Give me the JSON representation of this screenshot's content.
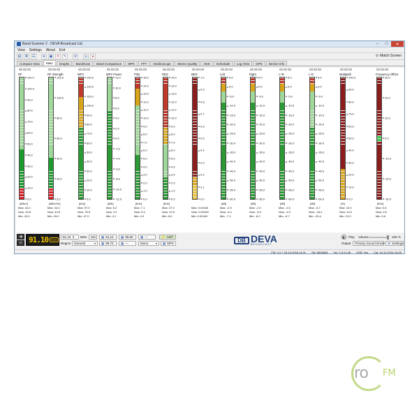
{
  "window": {
    "title": "Band Scanner 2 - DEVA Broadcast Ltd."
  },
  "menu": [
    "View",
    "Settings",
    "About",
    "Exit"
  ],
  "toolbar": {
    "match_screen": "Match Screen"
  },
  "tabs": [
    "Compact View",
    "Main",
    "Graphs",
    "BandScan",
    "Band Comparison",
    "MPX",
    "FFT",
    "Oscilloscope",
    "Stereo Quality",
    "ADS",
    "Scheduler",
    "Log View",
    "GPS",
    "Device Info"
  ],
  "active_tab": "Main",
  "meters": [
    {
      "title": "RF",
      "unit": "[dBuV]",
      "ticks": [
        "110.0",
        "100.0",
        "90.0",
        "80.0",
        "70.0",
        "60.0",
        "50.0",
        "40.0",
        "30.0",
        "20.0",
        "10.0",
        "0.0"
      ],
      "level": 0.4,
      "scheme": "rf",
      "stats": [
        "Max: 44.0",
        "Now: 43.8",
        "Min: 43.0"
      ]
    },
    {
      "title": "RF Strength",
      "unit": "[dBuV/m]",
      "ticks": [
        "125.0",
        "105.0",
        "85.0",
        "65.0",
        "45.0",
        "25.0",
        "5.0"
      ],
      "level": 0.33,
      "scheme": "rf",
      "stats": [
        "Max: 44.0",
        "Now: 43.8",
        "Min: 43.0"
      ]
    },
    {
      "title": "MPX",
      "unit": "[kHz]",
      "ticks": [
        "130.0",
        "120.0",
        "110.0",
        "100.0",
        "90.0",
        "80.0",
        "70.0",
        "60.0",
        "50.0",
        "40.0",
        "30.0",
        "20.0",
        "10.0",
        "0.0"
      ],
      "level": 0.62,
      "scheme": "mpx",
      "stats": [
        "Max: 97.0",
        "Now: 78.5",
        "Min: 47.0"
      ]
    },
    {
      "title": "MPX Power",
      "unit": "[dBr]",
      "ticks": [
        "12.0",
        "10.0",
        "8.0",
        "6.0",
        "4.0",
        "2.0",
        "0.0",
        "-2.0",
        "-4.0",
        "-6.0",
        "-8.0",
        "-10.0",
        "-12.0"
      ],
      "level": 0.72,
      "scheme": "green",
      "stats": [
        "Max: 6.2",
        "Now: 4.1",
        "Min: 4.1"
      ]
    },
    {
      "title": "Pilot",
      "unit": "[kHz]",
      "ticks": [
        "15.0",
        "14.0",
        "13.0",
        "12.0",
        "11.0",
        "10.0",
        "9.0",
        "8.0",
        "7.0",
        "6.0",
        "5.0",
        "4.0",
        "3.0",
        "2.0",
        "1.0",
        "0.0"
      ],
      "level": 0.36,
      "scheme": "pilot",
      "stats": [
        "Max: 7.1",
        "Now: 5.4",
        "Min: 4.3"
      ]
    },
    {
      "title": "RDS",
      "unit": "[kHz]",
      "ticks": [
        "15.0",
        "14.0",
        "13.0",
        "12.0",
        "11.0",
        "10.0",
        "9.0",
        "8.0",
        "7.0",
        "6.0",
        "5.0",
        "4.0",
        "3.0",
        "2.0",
        "1.0",
        "0.0"
      ],
      "level": 0.18,
      "scheme": "rds",
      "stats": [
        "Max: 27.0",
        "Now: 12.5",
        "Min: 8.0"
      ]
    },
    {
      "title": "BER",
      "unit": "",
      "ticks": [
        "1.0",
        "0.9",
        "0.8",
        "0.7",
        "0.6",
        "0.5",
        "0.4",
        "0.3",
        "0.2",
        "0.1",
        "0.0"
      ],
      "level": 0.0,
      "scheme": "ber",
      "stats": [
        "Max: 0.00160",
        "Now: 0.00160",
        "Min: 0.00160"
      ]
    },
    {
      "title": "Left",
      "unit": "[dB]",
      "ticks": [
        "5.0",
        "0.0",
        "-5.0",
        "-10.0",
        "-15.0",
        "-20.0",
        "-25.0",
        "-30.0",
        "-35.0",
        "-40.0",
        "-45.0",
        "-50.0",
        "-55.0",
        "-60.0"
      ],
      "level": 0.8,
      "scheme": "audio",
      "stats": [
        "Max: -2.5",
        "Now: -6.1",
        "Min: -7.1"
      ]
    },
    {
      "title": "Right",
      "unit": "[dB]",
      "ticks": [
        "5.0",
        "0.0",
        "-5.0",
        "-10.0",
        "-15.0",
        "-20.0",
        "-25.0",
        "-30.0",
        "-35.0",
        "-40.0",
        "-45.0",
        "-50.0",
        "-55.0",
        "-60.0"
      ],
      "level": 0.79,
      "scheme": "audio",
      "stats": [
        "Max: -2.0",
        "Now: -6.2",
        "Min: -8.2"
      ]
    },
    {
      "title": "L+R",
      "unit": "[dB]",
      "ticks": [
        "5.0",
        "0.0",
        "-5.0",
        "-10.0",
        "-15.0",
        "-20.0",
        "-25.0",
        "-30.0",
        "-35.0",
        "-40.0",
        "-45.0",
        "-50.0",
        "-55.0",
        "-60.0"
      ],
      "level": 0.8,
      "scheme": "audio",
      "stats": [
        "Max: -2.6",
        "Now: -5.2",
        "Min: -6.7"
      ]
    },
    {
      "title": "L-R",
      "unit": "[dB]",
      "ticks": [
        "5.0",
        "0.0",
        "-5.0",
        "-10.0",
        "-15.0",
        "-20.0",
        "-25.0",
        "-30.0",
        "-35.0",
        "-40.0",
        "-45.0",
        "-50.0",
        "-55.0",
        "-60.0"
      ],
      "level": 0.58,
      "scheme": "audio",
      "stats": [
        "Max: -8.7",
        "Now: -18.2",
        "Min: -23.4"
      ]
    },
    {
      "title": "Multipath",
      "unit": "[%]",
      "ticks": [
        "100.0",
        "90.0",
        "80.0",
        "70.0",
        "60.0",
        "50.0",
        "40.0",
        "30.0",
        "20.0",
        "10.0",
        "0.0"
      ],
      "level": 0.14,
      "scheme": "multipath",
      "stats": [
        "Max: 15.0",
        "Now: 14.0",
        "Min: 13.0"
      ]
    },
    {
      "title": "Frequency Offset",
      "unit": "[kHz]",
      "ticks": [
        "30.0",
        "20.0",
        "10.0",
        "0.0",
        "-10.0",
        "-20.0",
        "-30.0"
      ],
      "level": 0.5,
      "scheme": "offset",
      "stats": [
        "Max: 0.6",
        "Now: 0.6",
        "Min: 0.6"
      ]
    }
  ],
  "bottom": {
    "frequency": "91.10",
    "rds_badge": "RDS",
    "freq_input": "91.10",
    "freq_unit": "MHz",
    "set_label": "Set",
    "presets": [
      "91.10",
      "99.90",
      "---",
      "89.70",
      "---"
    ],
    "ant_label": "ANT",
    "region_label": "Region",
    "region_value": "General",
    "mono_value": "Mono",
    "mpx_label": "MPX",
    "brand": "DEVA",
    "brand_mark": "DB",
    "brand_sub": "BROADCAST",
    "play_label": "Play",
    "volume_label": "Volume",
    "volume_value": "100 %",
    "volume_level": 1.0,
    "output_label": "Output",
    "output_value": "Primary Sound Driver",
    "settings_label": "Settings"
  },
  "status": [
    "FW: 1.0.7 03-10-2016 11:01",
    "SN: 8526808",
    "Ver: 1.5.5.146",
    "SSR: Yes",
    "Cal: 10-12-2016 16:25"
  ],
  "watermark": {
    "text": "ro",
    "fm": "FM"
  }
}
